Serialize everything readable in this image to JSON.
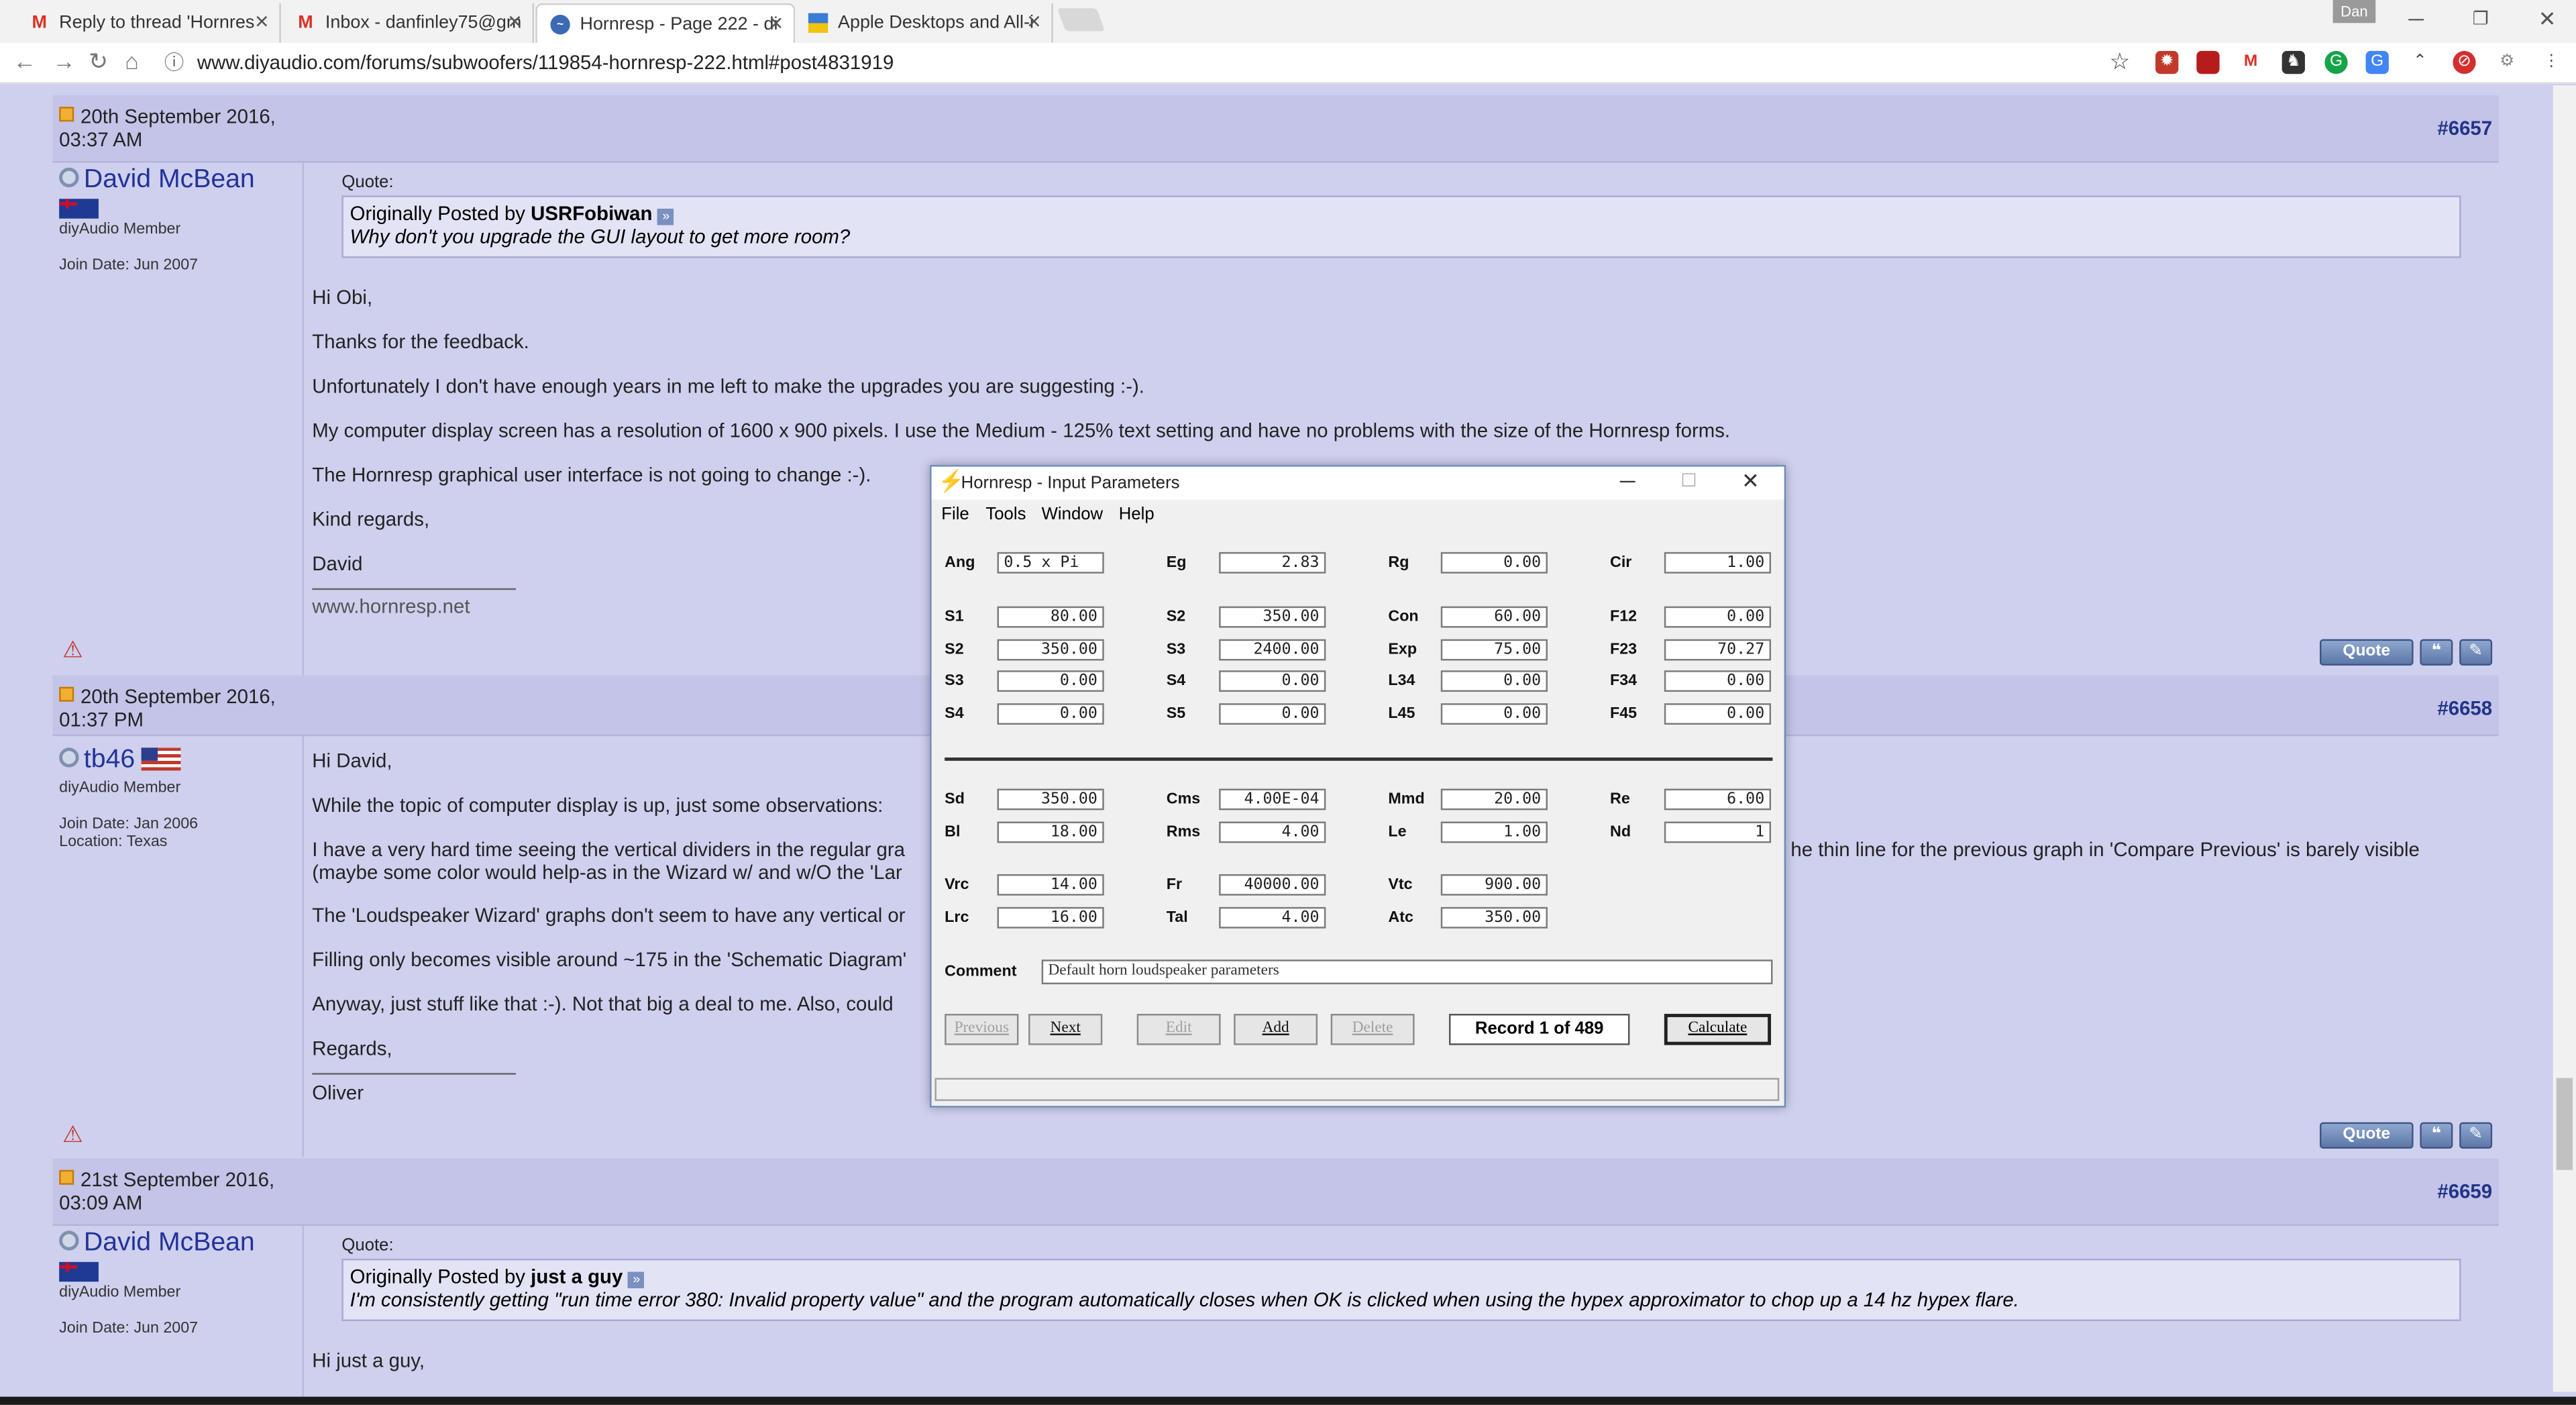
{
  "browser": {
    "tabs": [
      {
        "label": "Reply to thread 'Hornres",
        "icon": "gmail-icon"
      },
      {
        "label": "Inbox - danfinley75@gm",
        "icon": "gmail-icon"
      },
      {
        "label": "Hornresp - Page 222 - di",
        "icon": "diyaudio-icon"
      },
      {
        "label": "Apple Desktops and All-i",
        "icon": "store-icon"
      }
    ],
    "profile": "Dan",
    "url": "www.diyaudio.com/forums/subwoofers/119854-hornresp-222.html#post4831919"
  },
  "posts": [
    {
      "date": "20th September 2016,",
      "time": "03:37 AM",
      "number": "#6657",
      "user": "David McBean",
      "role": "diyAudio Member",
      "join": "Join Date: Jun 2007",
      "quote_label": "Quote:",
      "quote_prefix": "Originally Posted by",
      "quote_author": "USRFobiwan",
      "quote_text": "Why don't you upgrade the GUI layout to get more room?",
      "lines": [
        "Hi Obi,",
        "Thanks for the feedback.",
        "Unfortunately I don't have enough years in me left to make the upgrades you are suggesting :-).",
        "My computer display screen has a resolution of 1600 x 900 pixels. I use the Medium - 125% text setting and have no problems with the size of the Hornresp forms.",
        "The Hornresp graphical user interface is not going to change :-).",
        "Kind regards,",
        "David"
      ],
      "signature": "www.hornresp.net",
      "quote_button": "Quote"
    },
    {
      "date": "20th September 2016,",
      "time": "01:37 PM",
      "number": "#6658",
      "user": "tb46",
      "role": "diyAudio Member",
      "join": "Join Date: Jan 2006",
      "location": "Location: Texas",
      "lines": [
        "Hi David,",
        "While the topic of computer display is up, just some observations:",
        "I have a very hard time seeing the vertical dividers in the regular gra",
        "(maybe some color would help-as in the Wizard w/ and w/O the 'Lar",
        "The 'Loudspeaker Wizard' graphs don't seem to have any vertical or",
        "Filling only becomes visible around ~175 in the 'Schematic Diagram'",
        "Anyway, just stuff like that :-). Not that big a deal to me. Also, could",
        "Regards,",
        "Oliver"
      ],
      "line_tail": "he thin line for the previous graph in 'Compare Previous' is barely visible",
      "quote_button": "Quote"
    },
    {
      "date": "21st September 2016,",
      "time": "03:09 AM",
      "number": "#6659",
      "user": "David McBean",
      "role": "diyAudio Member",
      "join": "Join Date: Jun 2007",
      "quote_label": "Quote:",
      "quote_prefix": "Originally Posted by",
      "quote_author": "just a guy",
      "quote_text": "I'm consistently getting \"run time error 380: Invalid property value\" and the program automatically closes when OK is clicked when using the hypex approximator to chop up a 14 hz hypex flare.",
      "lines": [
        "Hi just a guy,"
      ]
    }
  ],
  "hornresp": {
    "title": "Hornresp - Input Parameters",
    "menu": [
      "File",
      "Tools",
      "Window",
      "Help"
    ],
    "row0": [
      {
        "label": "Ang",
        "value": "0.5 x Pi"
      },
      {
        "label": "Eg",
        "value": "2.83"
      },
      {
        "label": "Rg",
        "value": "0.00"
      },
      {
        "label": "Cir",
        "value": "1.00"
      }
    ],
    "block1": [
      [
        {
          "label": "S1",
          "value": "80.00"
        },
        {
          "label": "S2",
          "value": "350.00"
        },
        {
          "label": "Con",
          "value": "60.00"
        },
        {
          "label": "F12",
          "value": "0.00"
        }
      ],
      [
        {
          "label": "S2",
          "value": "350.00"
        },
        {
          "label": "S3",
          "value": "2400.00"
        },
        {
          "label": "Exp",
          "value": "75.00"
        },
        {
          "label": "F23",
          "value": "70.27"
        }
      ],
      [
        {
          "label": "S3",
          "value": "0.00"
        },
        {
          "label": "S4",
          "value": "0.00"
        },
        {
          "label": "L34",
          "value": "0.00"
        },
        {
          "label": "F34",
          "value": "0.00"
        }
      ],
      [
        {
          "label": "S4",
          "value": "0.00"
        },
        {
          "label": "S5",
          "value": "0.00"
        },
        {
          "label": "L45",
          "value": "0.00"
        },
        {
          "label": "F45",
          "value": "0.00"
        }
      ]
    ],
    "block2": [
      [
        {
          "label": "Sd",
          "value": "350.00"
        },
        {
          "label": "Cms",
          "value": "4.00E-04"
        },
        {
          "label": "Mmd",
          "value": "20.00"
        },
        {
          "label": "Re",
          "value": "6.00"
        }
      ],
      [
        {
          "label": "Bl",
          "value": "18.00"
        },
        {
          "label": "Rms",
          "value": "4.00"
        },
        {
          "label": "Le",
          "value": "1.00"
        },
        {
          "label": "Nd",
          "value": "1"
        }
      ]
    ],
    "block3": [
      [
        {
          "label": "Vrc",
          "value": "14.00"
        },
        {
          "label": "Fr",
          "value": "40000.00"
        },
        {
          "label": "Vtc",
          "value": "900.00"
        }
      ],
      [
        {
          "label": "Lrc",
          "value": "16.00"
        },
        {
          "label": "Tal",
          "value": "4.00"
        },
        {
          "label": "Atc",
          "value": "350.00"
        }
      ]
    ],
    "comment_label": "Comment",
    "comment": "Default horn loudspeaker parameters",
    "buttons": {
      "previous": "Previous",
      "next": "Next",
      "edit": "Edit",
      "add": "Add",
      "delete": "Delete",
      "calculate": "Calculate"
    },
    "record": "Record 1 of 489"
  }
}
